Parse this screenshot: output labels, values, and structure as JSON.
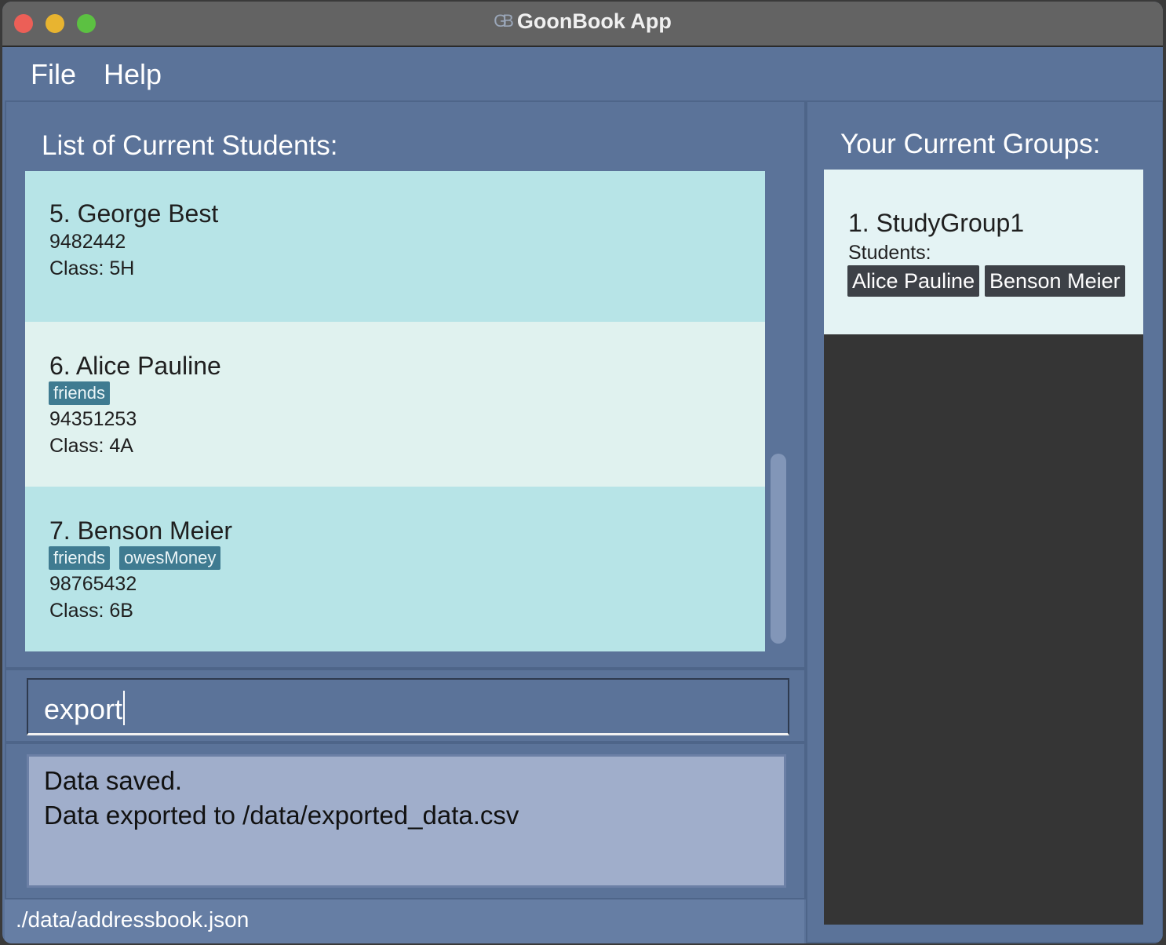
{
  "window": {
    "title": "GoonBook App",
    "app_icon": "GB"
  },
  "menu": {
    "file": "File",
    "help": "Help"
  },
  "students": {
    "heading": "List of Current Students:",
    "items": [
      {
        "name": "5. George Best",
        "tags": [],
        "phone": "9482442",
        "class": "Class: 5H"
      },
      {
        "name": "6. Alice Pauline",
        "tags": [
          "friends"
        ],
        "phone": "94351253",
        "class": "Class: 4A"
      },
      {
        "name": "7. Benson Meier",
        "tags": [
          "friends",
          "owesMoney"
        ],
        "phone": "98765432",
        "class": "Class: 6B"
      }
    ]
  },
  "command": {
    "value": "export"
  },
  "result": {
    "line1": "Data saved.",
    "line2": "Data exported to /data/exported_data.csv"
  },
  "status_bar": {
    "path": "./data/addressbook.json"
  },
  "groups": {
    "heading": "Your Current Groups:",
    "items": [
      {
        "name": "1. StudyGroup1",
        "subheading": "Students:",
        "members": [
          "Alice Pauline",
          "Benson Meier"
        ]
      }
    ]
  },
  "colors": {
    "window_bg": "#5b7399",
    "card_alt_1": "#b7e4e7",
    "card_alt_2": "#e0f2ef",
    "tag_bg": "#3f7b91",
    "group_chip_bg": "#3d4147",
    "result_bg": "#a0aecb"
  }
}
